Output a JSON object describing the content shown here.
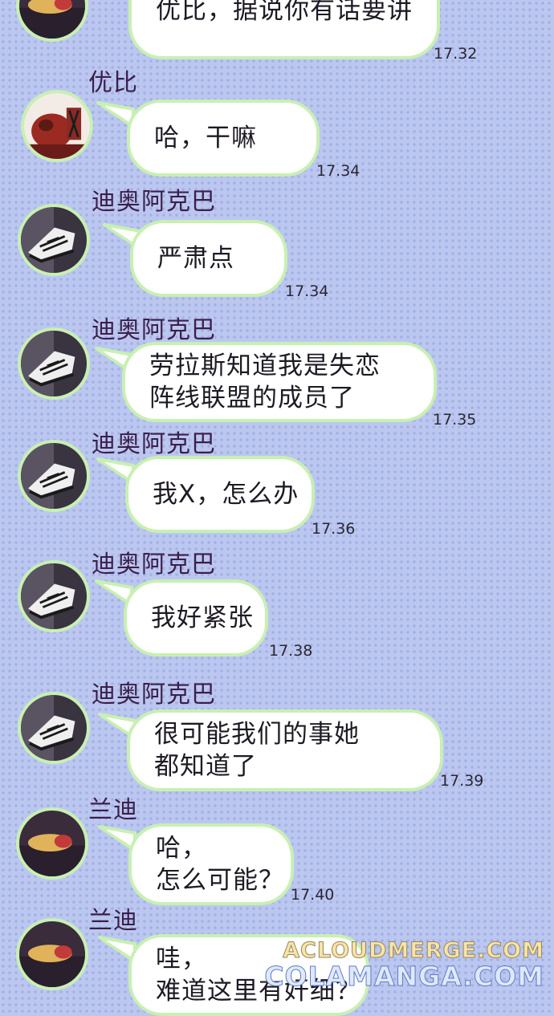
{
  "messages": [
    {
      "sender": "",
      "avatar": "bear-avatar",
      "lines": [
        "优比，据说你有话要讲"
      ],
      "time": "17.32"
    },
    {
      "sender": "优比",
      "avatar": "tiger-avatar",
      "lines": [
        "哈，干嘛"
      ],
      "time": "17.34"
    },
    {
      "sender": "迪奥阿克巴",
      "avatar": "sneaker-avatar",
      "lines": [
        "严肃点"
      ],
      "time": "17.34"
    },
    {
      "sender": "迪奥阿克巴",
      "avatar": "sneaker-avatar",
      "lines": [
        "劳拉斯知道我是失恋",
        "阵线联盟的成员了"
      ],
      "time": "17.35"
    },
    {
      "sender": "迪奥阿克巴",
      "avatar": "sneaker-avatar",
      "lines": [
        "我X，怎么办"
      ],
      "time": "17.36"
    },
    {
      "sender": "迪奥阿克巴",
      "avatar": "sneaker-avatar",
      "lines": [
        "我好紧张"
      ],
      "time": "17.38"
    },
    {
      "sender": "迪奥阿克巴",
      "avatar": "sneaker-avatar",
      "lines": [
        "很可能我们的事她",
        "都知道了"
      ],
      "time": "17.39"
    },
    {
      "sender": "兰迪",
      "avatar": "bear-avatar",
      "lines": [
        "哈，",
        "怎么可能？"
      ],
      "time": "17.40"
    },
    {
      "sender": "兰迪",
      "avatar": "bear-avatar",
      "lines": [
        "哇，",
        "难道这里有奸细？"
      ],
      "time": ""
    }
  ],
  "watermarks": [
    "ACLOUDMERGE.COM",
    "COLAMANGA.COM"
  ],
  "colors": {
    "background": "#bcc7ef",
    "bubble_fill": "#ffffff",
    "bubble_border": "#c8f0b2",
    "sender_text": "#3b1f4a"
  }
}
